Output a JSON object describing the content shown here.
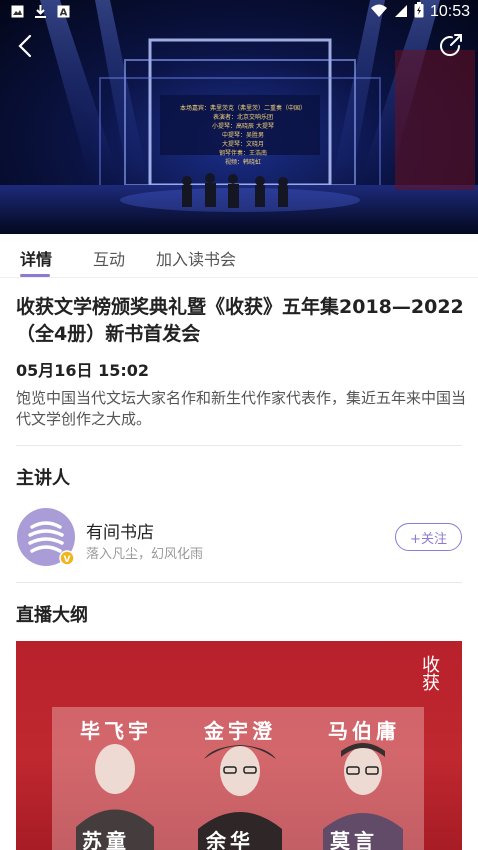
{
  "status_bar": {
    "time": "10:53",
    "left_icons": [
      "image-icon",
      "download-icon",
      "app-icon"
    ],
    "right_icons": [
      "wifi-icon",
      "signal-icon",
      "battery-icon"
    ]
  },
  "video": {
    "screen_credits": [
      "本场嘉宾：弗里茨克（弗里茨）二重奏（中国）",
      "表演者：北京交响乐团",
      "小提琴：高晓辰 大提琴",
      "中提琴：吴胜男",
      "大提琴：文晓月",
      "钢琴伴奏：王浩南",
      "视频：韩晓虹"
    ]
  },
  "tabs": [
    {
      "label": "详情",
      "active": true
    },
    {
      "label": "互动",
      "active": false
    },
    {
      "label": "加入读书会",
      "active": false
    }
  ],
  "event": {
    "title": "收获文学榜颁奖典礼暨《收获》五年集2018—2022（全4册）新书首发会",
    "datetime": "05月16日 15:02",
    "description": "饱览中国当代文坛大家名作和新生代作家代表作，集近五年来中国当代文学创作之大成。"
  },
  "host_section": {
    "title": "主讲人",
    "host_name": "有间书店",
    "host_tagline": "落入凡尘，幻风化雨",
    "follow_label": "+关注",
    "badge": "V"
  },
  "outline_section": {
    "title": "直播大纲",
    "poster_names_row1": [
      "毕飞宇",
      "金宇澄",
      "马伯庸"
    ],
    "poster_names_row2": [
      "苏童",
      "余华",
      "莫言"
    ],
    "poster_seal": "收获"
  },
  "colors": {
    "accent": "#8f7ad1",
    "poster_red": "#b8212b"
  }
}
